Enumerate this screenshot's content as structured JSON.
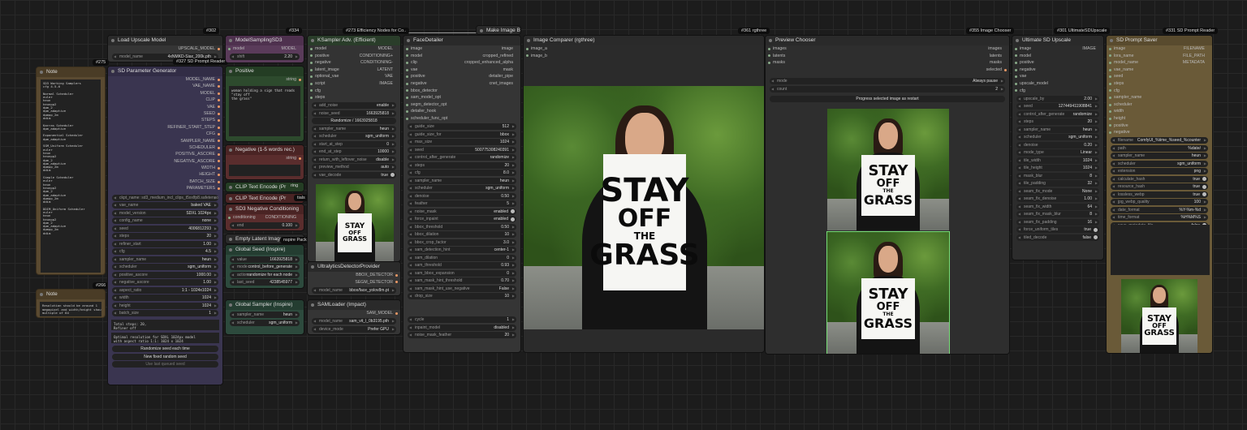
{
  "note1": {
    "title": "Note",
    "badge": "#275",
    "text": "SD3 Working Samplers\ncfg 4.5-6\n\nNormal Scheduler\neuler\nheun\nheunpp2\ndpm_2\ndpm_adaptive\ndpmpp_2m\nddim\n\nKarras Scheduler\ndpm_adaptive\n\nExponential Scheduler\ndpm_adaptive\n\nSGM_Uniform Scheduler\neuler\nheun\nheunpp2\ndpm_2\ndpm_adaptive\ndpmpp_2m\nddim\n\nSimple Scheduler\neuler\nheun\nheunpp2\ndpm_2\ndpm_adaptive\ndpmpp_2m\nddim\n\nDDIM_Uniform Scheduler\neuler\nheun\nheunpp2\ndpm_2\ndpm_adaptive\ndpmpp_2m\nddim"
  },
  "note2": {
    "title": "Note",
    "badge": "#266",
    "text": "Resolution should be around 1\nmegapixel and width/height should be\nmultiple of 64"
  },
  "upscale": {
    "title": "Load Upscale Model",
    "badge": "#302",
    "out": "UPSCALE_MODEL",
    "w_label": "model_name",
    "w_val": "4xNMKD-Siax_200k.pth",
    "reader_badge": "#327 SD Prompt Reader"
  },
  "sdparam": {
    "title": "SD Parameter Generator",
    "outs": [
      "MODEL_NAME",
      "VAE_NAME",
      "MODEL",
      "CLIP",
      "VAE",
      "SEED",
      "STEPS",
      "REFINER_START_STEP",
      "CFG",
      "SAMPLER_NAME",
      "SCHEDULER",
      "POSITIVE_ASCORE",
      "NEGATIVE_ASCORE",
      "WIDTH",
      "HEIGHT",
      "BATCH_SIZE",
      "PARAMETERS"
    ],
    "ckpt": "ckpt_name: sd3_medium_incl_clips_t5xxlfp8.safetensors",
    "widgets": [
      [
        "vae_name",
        "baked VAE"
      ],
      [
        "model_version",
        "SDXL 1024px"
      ],
      [
        "config_name",
        "none"
      ],
      [
        "seed",
        "4006812293"
      ],
      [
        "steps",
        "20"
      ],
      [
        "refiner_start",
        "1.00"
      ],
      [
        "cfg",
        "4.5"
      ],
      [
        "sampler_name",
        "heun"
      ],
      [
        "scheduler",
        "sgm_uniform"
      ],
      [
        "positive_ascore",
        "1000.00"
      ],
      [
        "negative_ascore",
        "1.00"
      ],
      [
        "aspect_ratio",
        "1:1 - 1024x1024"
      ],
      [
        "width",
        "1024"
      ],
      [
        "height",
        "1024"
      ],
      [
        "batch_size",
        "1"
      ]
    ],
    "info1": "Total steps: 20,\nRefiner off",
    "info2": "Optimal resolution for SDXL 1024px model\nwith aspect ratio 1:1: 1024 x 1024",
    "btn1": "Randomize seed each time",
    "btn2": "New fixed random seed",
    "btn3": "Use last queued seed"
  },
  "msd3": {
    "title": "ModelSamplingSD3",
    "badge": "#334",
    "in": "model",
    "out": "MODEL",
    "w_label": "shift",
    "w_val": "2.20"
  },
  "pos": {
    "title": "Positive",
    "out": "string",
    "text": "woman holding a sign that reads \"stay off\nthe grass\""
  },
  "neg": {
    "title": "Negative (1-5 words rec.)",
    "out": "string"
  },
  "clip1": {
    "title": "CLIP Text Encode (Pr",
    "out": "ring"
  },
  "clip2": {
    "title": "CLIP Text Encode (Pr",
    "out": "tials"
  },
  "sd3neg": {
    "title": "SD3 Negative Conditioning",
    "in": "conditioning",
    "out": "CONDITIONING",
    "w_label": "end",
    "w_val": "0.100"
  },
  "empty": {
    "title": "Empty Latent Image",
    "badge": "nspire Pack"
  },
  "gseed": {
    "title": "Global Seed (Inspire)",
    "w": [
      [
        "value",
        "1663925818"
      ],
      [
        "mode",
        "control_before_generate"
      ],
      [
        "action",
        "randomize for each node"
      ]
    ],
    "last_label": "last_seed",
    "last_val": "4238545977"
  },
  "gsamp": {
    "title": "Global Sampler (Inspire)",
    "w": [
      [
        "sampler_name",
        "heun"
      ],
      [
        "scheduler",
        "sgm_uniform"
      ]
    ]
  },
  "ksampler": {
    "title": "KSampler Adv. (Efficient)",
    "badge": "#273 Efficiency Nodes for Co..",
    "ins": [
      "model",
      "positive",
      "negative",
      "latent_image",
      "optional_vae",
      "script"
    ],
    "outs": [
      "MODEL",
      "CONDITIONING+",
      "CONDITIONING-",
      "LATENT",
      "VAE",
      "IMAGE"
    ],
    "cfg": "cfg",
    "steps": "steps",
    "w": [
      [
        "add_noise",
        "enable"
      ],
      [
        "noise_seed",
        "1663925818"
      ]
    ],
    "rand": "Randomize / 1663925818",
    "w2": [
      [
        "sampler_name",
        "heun"
      ],
      [
        "scheduler",
        "sgm_uniform"
      ],
      [
        "start_at_step",
        "0"
      ],
      [
        "end_at_step",
        "10000"
      ],
      [
        "return_with_leftover_noise",
        "disable"
      ],
      [
        "preview_method",
        "auto"
      ],
      [
        "vae_decode",
        "true"
      ]
    ]
  },
  "ultra": {
    "title": "UltralyticsDetectorProvider",
    "outs": [
      "BBOX_DETECTOR",
      "SEGM_DETECTOR"
    ],
    "w_label": "model_name",
    "w_val": "bbox/face_yolov8m.pt"
  },
  "sam": {
    "title": "SAMLoader (Impact)",
    "out": "SAM_MODEL",
    "w": [
      [
        "model_name",
        "sam_vit_l_0b3195.pth"
      ],
      [
        "device_mode",
        "Prefer GPU"
      ]
    ]
  },
  "face": {
    "title": "FaceDetailer",
    "ins": [
      "image",
      "model",
      "clip",
      "vae",
      "positive",
      "negative",
      "bbox_detector",
      "sam_model_opt",
      "segm_detector_opt",
      "detailer_hook",
      "scheduler_func_opt"
    ],
    "outs": [
      "image",
      "cropped_refined",
      "cropped_enhanced_alpha",
      "mask",
      "detailer_pipe",
      "cnet_images"
    ],
    "w": [
      [
        "guide_size",
        "512"
      ],
      [
        "guide_size_for",
        "bbox"
      ],
      [
        "max_size",
        "1024"
      ],
      [
        "seed",
        "500775308240391"
      ],
      [
        "control_after_generate",
        "randomize"
      ],
      [
        "steps",
        "20"
      ],
      [
        "cfg",
        "8.0"
      ],
      [
        "sampler_name",
        "heun"
      ],
      [
        "scheduler",
        "sgm_uniform"
      ],
      [
        "denoise",
        "0.50"
      ],
      [
        "feather",
        "5"
      ],
      [
        "noise_mask",
        "enabled"
      ],
      [
        "force_inpaint",
        "enabled"
      ],
      [
        "bbox_threshold",
        "0.50"
      ],
      [
        "bbox_dilation",
        "10"
      ],
      [
        "bbox_crop_factor",
        "3.0"
      ],
      [
        "sam_detection_hint",
        "center-1"
      ],
      [
        "sam_dilation",
        "0"
      ],
      [
        "sam_threshold",
        "0.93"
      ],
      [
        "sam_bbox_expansion",
        "0"
      ],
      [
        "sam_mask_hint_threshold",
        "0.70"
      ],
      [
        "sam_mask_hint_use_negative",
        "False"
      ],
      [
        "drop_size",
        "10"
      ]
    ],
    "w2": [
      [
        "cycle",
        "1"
      ],
      [
        "inpaint_model",
        "disabled"
      ],
      [
        "noise_mask_feather",
        "20"
      ]
    ]
  },
  "mib": {
    "title": "Make Image Batch"
  },
  "comparer": {
    "title": "Image Comparer (rgthree)",
    "badge": "#361 rgthree",
    "ins": [
      "image_a",
      "image_b"
    ]
  },
  "chooser": {
    "title": "Preview Chooser",
    "badge": "#355 Image Chooser",
    "ins": [
      "images",
      "latents",
      "masks"
    ],
    "outs": [
      "images",
      "latents",
      "masks",
      "selected"
    ],
    "w": [
      [
        "mode",
        "Always pause"
      ],
      [
        "count",
        "2"
      ]
    ],
    "banner": "Progress selected image as restart"
  },
  "usd": {
    "title": "Ultimate SD Upscale",
    "badge": "#301 UltimateSDUpscale",
    "ins": [
      "image",
      "model",
      "positive",
      "negative",
      "vae",
      "upscale_model",
      "cfg"
    ],
    "out": "IMAGE",
    "w": [
      [
        "upscale_by",
        "2.00"
      ],
      [
        "seed",
        "127449411908841"
      ],
      [
        "control_after_generate",
        "randomize"
      ],
      [
        "steps",
        "20"
      ],
      [
        "sampler_name",
        "heun"
      ],
      [
        "scheduler",
        "sgm_uniform"
      ],
      [
        "denoise",
        "0.20"
      ],
      [
        "mode_type",
        "Linear"
      ],
      [
        "tile_width",
        "1024"
      ],
      [
        "tile_height",
        "1024"
      ],
      [
        "mask_blur",
        "8"
      ],
      [
        "tile_padding",
        "32"
      ],
      [
        "seam_fix_mode",
        "None"
      ],
      [
        "seam_fix_denoise",
        "1.00"
      ],
      [
        "seam_fix_width",
        "64"
      ],
      [
        "seam_fix_mask_blur",
        "8"
      ],
      [
        "seam_fix_padding",
        "16"
      ],
      [
        "force_uniform_tiles",
        "true"
      ],
      [
        "tiled_decode",
        "false"
      ]
    ]
  },
  "saver": {
    "title": "SD Prompt Saver",
    "badge": "#331 SD Prompt Reader",
    "ins": [
      "image",
      "lora_name",
      "model_name",
      "vae_name",
      "seed",
      "steps",
      "cfg",
      "sampler_name",
      "scheduler",
      "width",
      "height",
      "positive",
      "negative"
    ],
    "outs": [
      "FILENAME",
      "FILE_PATH",
      "METADATA"
    ],
    "w": [
      [
        "filename",
        "ComfyUI_%time_%seed_%counter"
      ],
      [
        "path",
        "%date/"
      ],
      [
        "sampler_name",
        "heun"
      ],
      [
        "scheduler",
        "sgm_uniform"
      ],
      [
        "extension",
        "png"
      ],
      [
        "calculate_hash",
        "true"
      ],
      [
        "resource_hash",
        "true"
      ],
      [
        "lossless_webp",
        "true"
      ],
      [
        "jpg_webp_quality",
        "100"
      ],
      [
        "date_format",
        "%Y-%m-%d"
      ],
      [
        "time_format",
        "%H%M%S"
      ],
      [
        "save_metadata_file",
        "false"
      ]
    ]
  },
  "sign": {
    "l1": "STAY",
    "l2": "OFF",
    "l3": "THE",
    "l4": "GRASS"
  }
}
